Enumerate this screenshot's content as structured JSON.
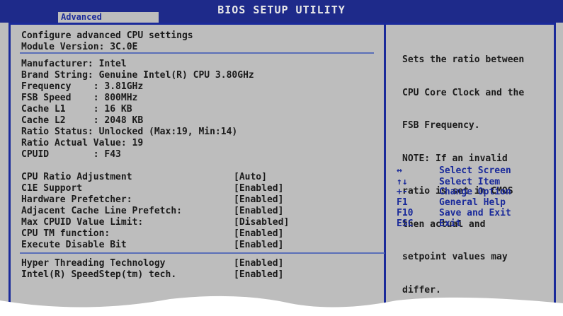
{
  "header": {
    "title": "BIOS SETUP UTILITY",
    "active_tab": "Advanced"
  },
  "main": {
    "heading": "Configure advanced CPU settings",
    "module_version": "Module Version: 3C.0E",
    "info_lines": [
      "Manufacturer: Intel",
      "Brand String: Genuine Intel(R) CPU 3.80GHz",
      "Frequency    : 3.81GHz",
      "FSB Speed    : 800MHz",
      "Cache L1     : 16 KB",
      "Cache L2     : 2048 KB",
      "Ratio Status: Unlocked (Max:19, Min:14)",
      "Ratio Actual Value: 19",
      "CPUID        : F43"
    ],
    "settings": [
      {
        "label": "CPU Ratio Adjustment",
        "value": "[Auto]"
      },
      {
        "label": "C1E Support",
        "value": "[Enabled]"
      },
      {
        "label": "Hardware Prefetcher:",
        "value": "[Enabled]"
      },
      {
        "label": "Adjacent Cache Line Prefetch:",
        "value": "[Enabled]"
      },
      {
        "label": "Max CPUID Value Limit:",
        "value": "[Disabled]"
      },
      {
        "label": "CPU TM function:",
        "value": "[Enabled]"
      },
      {
        "label": "Execute Disable Bit",
        "value": "[Enabled]"
      }
    ],
    "settings2": [
      {
        "label": "Hyper Threading Technology",
        "value": "[Enabled]"
      },
      {
        "label": "Intel(R) SpeedStep(tm) tech.",
        "value": "[Enabled]"
      }
    ]
  },
  "help": {
    "text_lines": [
      "Sets the ratio between",
      "CPU Core Clock and the",
      "FSB Frequency.",
      "NOTE: If an invalid",
      "ratio is set in CMOS",
      "then actual and",
      "setpoint values may",
      "differ."
    ],
    "keys": [
      {
        "key": "↔",
        "label": "Select Screen"
      },
      {
        "key": "↑↓",
        "label": "Select Item"
      },
      {
        "key": "+-",
        "label": "Change Option"
      },
      {
        "key": "F1",
        "label": "General Help"
      },
      {
        "key": "F10",
        "label": "Save and Exit"
      },
      {
        "key": "ESC",
        "label": "Exit"
      }
    ]
  },
  "colors": {
    "bios_blue": "#1a2a9a",
    "background": "#bdbdbd",
    "text": "#1b1b1b"
  }
}
